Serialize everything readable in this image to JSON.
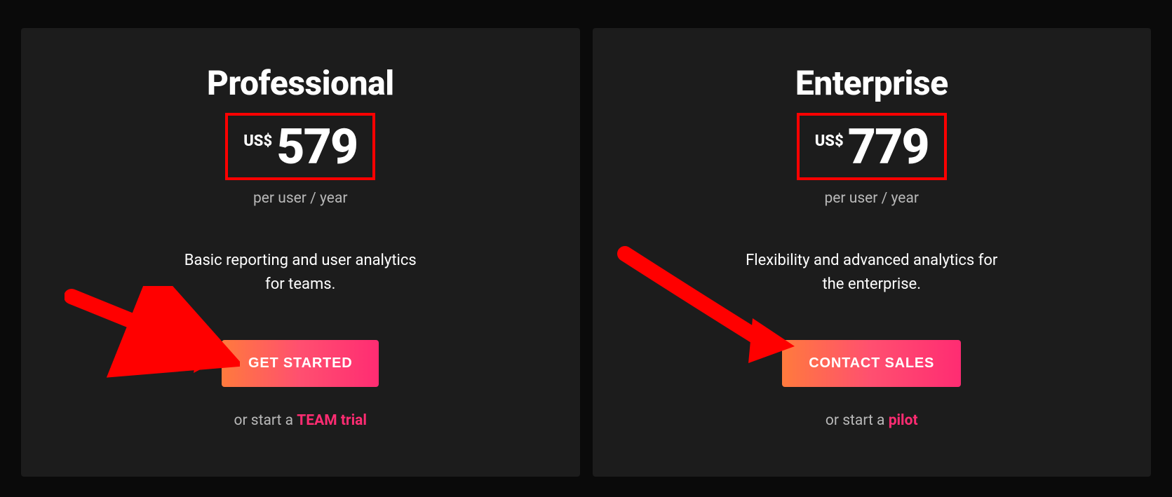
{
  "plans": [
    {
      "title": "Professional",
      "currency": "US$",
      "amount": "579",
      "period": "per user / year",
      "description": "Basic reporting and user analytics for teams.",
      "cta": "GET STARTED",
      "alt_prefix": "or start a ",
      "alt_highlight": "TEAM trial"
    },
    {
      "title": "Enterprise",
      "currency": "US$",
      "amount": "779",
      "period": "per user / year",
      "description": "Flexibility and advanced analytics for the enterprise.",
      "cta": "CONTACT SALES",
      "alt_prefix": "or start a ",
      "alt_highlight": "pilot"
    }
  ]
}
